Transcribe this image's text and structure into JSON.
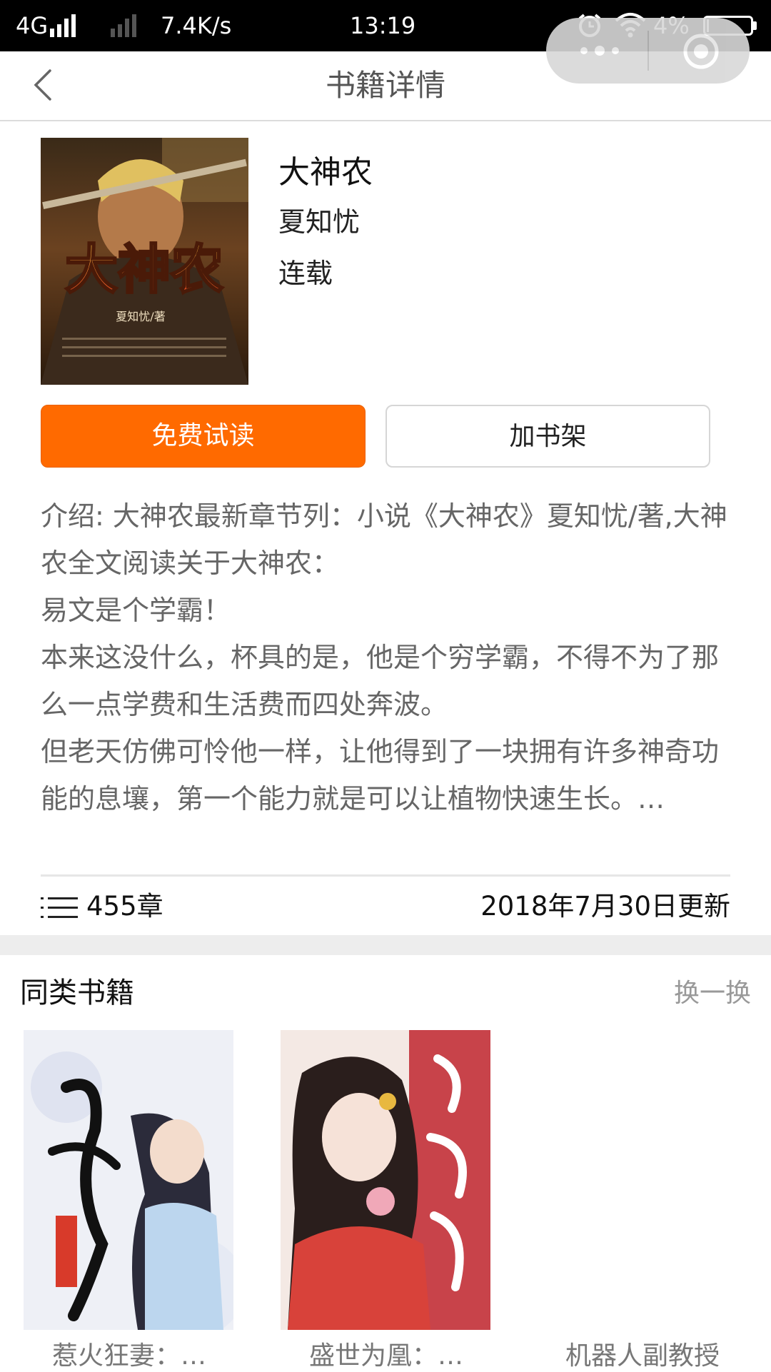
{
  "status_bar": {
    "network": "4G",
    "speed": "7.4K/s",
    "time": "13:19",
    "battery": "4%"
  },
  "nav": {
    "title": "书籍详情"
  },
  "book": {
    "title": "大神农",
    "author": "夏知忧",
    "status": "连载",
    "cover_text": "大神农",
    "cover_author": "夏知忧/著"
  },
  "actions": {
    "read_label": "免费试读",
    "shelf_label": "加书架"
  },
  "intro": {
    "lines": [
      "介绍: 大神农最新章节列：小说《大神农》夏知忧/著,大神农全文阅读关于大神农：",
      "易文是个学霸！",
      "本来这没什么，杯具的是，他是个穷学霸，不得不为了那么一点学费和生活费而四处奔波。",
      "但老天仿佛可怜他一样，让他得到了一块拥有许多神奇功能的息壤，第一个能力就是可以让植物快速生长。…"
    ]
  },
  "meta": {
    "chapters": "455章",
    "updated": "2018年7月30日更新"
  },
  "related": {
    "title": "同类书籍",
    "refresh_label": "换一换",
    "items": [
      {
        "name": "惹火狂妻：…"
      },
      {
        "name": "盛世为凰：…"
      },
      {
        "name": "机器人副教授"
      }
    ]
  },
  "colors": {
    "accent": "#ff6a00",
    "status_bar_bg": "#000000"
  }
}
